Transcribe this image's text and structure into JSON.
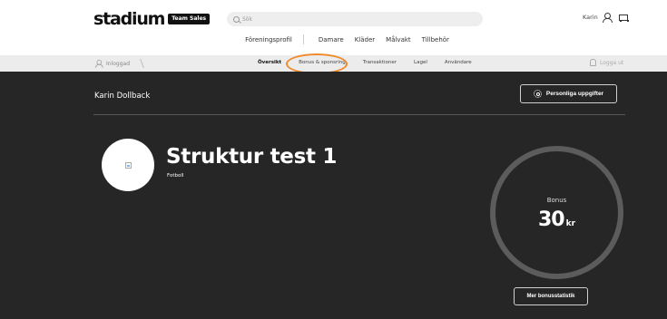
{
  "header": {
    "logo_text": "stadium",
    "logo_badge": "Team Sales",
    "search_placeholder": "Sök",
    "user_name": "Karin"
  },
  "main_nav": {
    "items": [
      "Föreningsprofil",
      "Damare",
      "Kläder",
      "Målvakt",
      "Tillbehör"
    ]
  },
  "subnav": {
    "login_label": "Inloggad",
    "tabs": [
      "Översikt",
      "Bonus & sponsring",
      "Transaktioner",
      "Lagel",
      "Användare"
    ],
    "logout_label": "Logga ut",
    "highlight_color": "#f08a2c"
  },
  "account": {
    "name": "Karin Dollback",
    "personal_button": "Personliga uppgifter"
  },
  "club": {
    "name": "Struktur test 1",
    "sport": "Fotboll"
  },
  "bonus": {
    "label": "Bonus",
    "value": "30",
    "unit": "kr",
    "stats_button": "Mer bonusstatistik"
  },
  "colors": {
    "dark_bg": "#262626",
    "ring": "#5c5c5c",
    "subnav_bg": "#ececec"
  }
}
